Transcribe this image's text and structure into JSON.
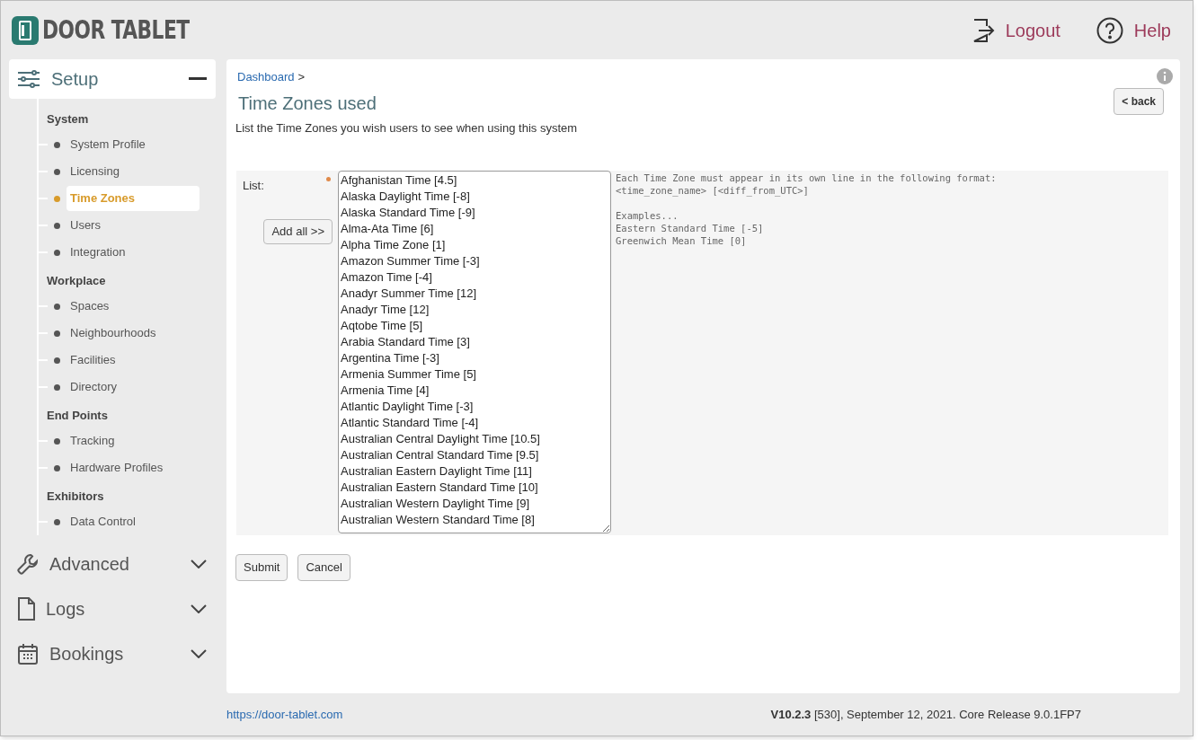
{
  "header": {
    "logo_text": "DOOR TABLET",
    "links": [
      {
        "kind": "logout",
        "label": "Logout"
      },
      {
        "kind": "help",
        "label": "Help"
      }
    ]
  },
  "sidebar": {
    "menus": [
      {
        "kind": "setup",
        "label": "Setup",
        "expanded": true,
        "groups": [
          {
            "title": "System",
            "items": [
              {
                "label": "System Profile",
                "selected": false
              },
              {
                "label": "Licensing",
                "selected": false
              },
              {
                "label": "Time Zones",
                "selected": true
              },
              {
                "label": "Users",
                "selected": false
              },
              {
                "label": "Integration",
                "selected": false
              }
            ]
          },
          {
            "title": "Workplace",
            "items": [
              {
                "label": "Spaces",
                "selected": false
              },
              {
                "label": "Neighbourhoods",
                "selected": false
              },
              {
                "label": "Facilities",
                "selected": false
              },
              {
                "label": "Directory",
                "selected": false
              }
            ]
          },
          {
            "title": "End Points",
            "items": [
              {
                "label": "Tracking",
                "selected": false
              },
              {
                "label": "Hardware Profiles",
                "selected": false
              }
            ]
          },
          {
            "title": "Exhibitors",
            "items": [
              {
                "label": "Data Control",
                "selected": false
              }
            ]
          }
        ]
      },
      {
        "kind": "advanced",
        "label": "Advanced",
        "expanded": false
      },
      {
        "kind": "logs",
        "label": "Logs",
        "expanded": false
      },
      {
        "kind": "bookings",
        "label": "Bookings",
        "expanded": false
      }
    ]
  },
  "content": {
    "breadcrumb": {
      "link": "Dashboard",
      "separator": ">"
    },
    "title": "Time Zones used",
    "back_button": "< back",
    "description": "List the Time Zones you wish users to see when using this system",
    "form": {
      "field_label": "List:",
      "required": true,
      "add_all_button": "Add all >>",
      "list_lines": [
        "Afghanistan Time [4.5]",
        "Alaska Daylight Time [-8]",
        "Alaska Standard Time [-9]",
        "Alma-Ata Time [6]",
        "Alpha Time Zone [1]",
        "Amazon Summer Time [-3]",
        "Amazon Time [-4]",
        "Anadyr Summer Time [12]",
        "Anadyr Time [12]",
        "Aqtobe Time [5]",
        "Arabia Standard Time [3]",
        "Argentina Time [-3]",
        "Armenia Summer Time [5]",
        "Armenia Time [4]",
        "Atlantic Daylight Time [-3]",
        "Atlantic Standard Time [-4]",
        "Australian Central Daylight Time [10.5]",
        "Australian Central Standard Time [9.5]",
        "Australian Eastern Daylight Time [11]",
        "Australian Eastern Standard Time [10]",
        "Australian Western Daylight Time [9]",
        "Australian Western Standard Time [8]"
      ],
      "help_paragraphs": [
        [
          "Each Time Zone must appear in its own line in the following format:",
          "<time_zone_name> [<diff_from_UTC>]"
        ],
        [
          "Examples...",
          "Eastern Standard Time [-5]",
          "Greenwich Mean Time [0]"
        ]
      ]
    },
    "buttons": [
      "Submit",
      "Cancel"
    ]
  },
  "footer": {
    "link": "https://door-tablet.com",
    "version": "V10.2.3",
    "release": " [530], September 12, 2021. Core Release 9.0.1FP7"
  }
}
